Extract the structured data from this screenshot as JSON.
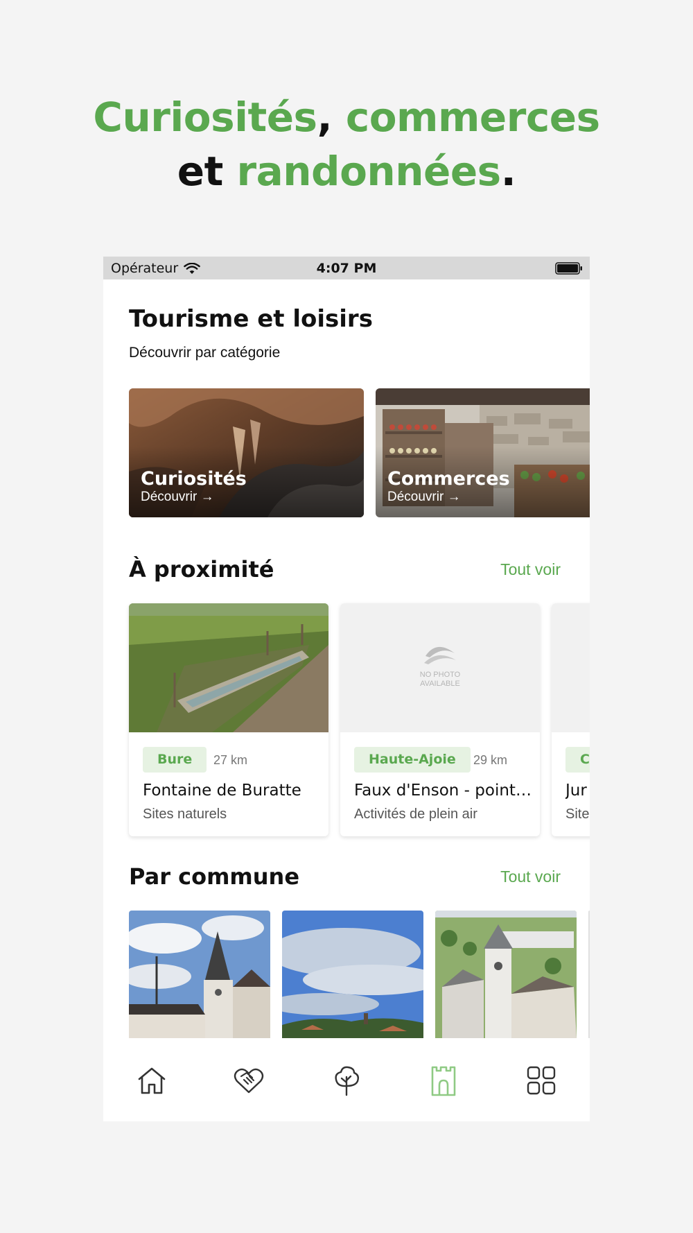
{
  "headline": {
    "part1": "Curiosités",
    "sep1": ", ",
    "part2": "commerces",
    "part3": "et ",
    "part4": "randonnées",
    "end": "."
  },
  "status_bar": {
    "carrier": "Opérateur",
    "time": "4:07 PM"
  },
  "screen": {
    "title": "Tourisme et loisirs",
    "subtitle": "Découvrir par catégorie"
  },
  "categories": [
    {
      "label": "Curiosités",
      "cta": "Découvrir →"
    },
    {
      "label": "Commerces",
      "cta": "Découvrir →"
    }
  ],
  "nearby": {
    "title": "À proximité",
    "see_all": "Tout voir",
    "items": [
      {
        "badge": "Bure",
        "distance": "27 km",
        "name": "Fontaine de Buratte",
        "category": "Sites naturels"
      },
      {
        "badge": "Haute-Ajoie",
        "distance": "29 km",
        "name": "Faux d'Enson - point…",
        "category": "Activités de plein air",
        "placeholder": "NO PHOTO AVAILABLE"
      },
      {
        "badge": "C",
        "name": "Jur",
        "category": "Site"
      }
    ]
  },
  "communes": {
    "title": "Par commune",
    "see_all": "Tout voir"
  },
  "tabbar": {
    "items": [
      "home-icon",
      "handshake-icon",
      "tree-icon",
      "castle-icon",
      "grid-icon"
    ],
    "active_index": 3
  },
  "colors": {
    "accent": "#5aa84f",
    "badge_bg": "#e6f2e2",
    "status_bar": "#d8d8d8",
    "page_bg": "#f4f4f4"
  }
}
